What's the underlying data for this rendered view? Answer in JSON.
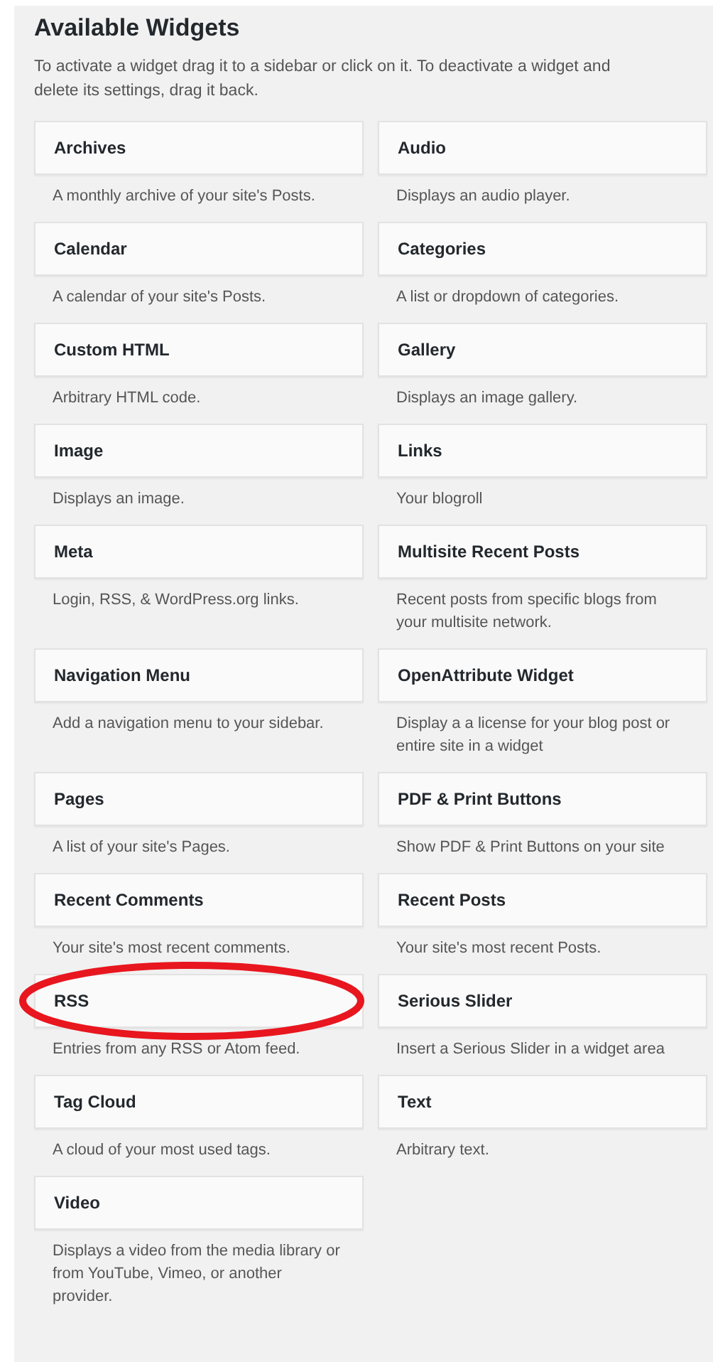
{
  "title": "Available Widgets",
  "intro": "To activate a widget drag it to a sidebar or click on it. To deactivate a widget and delete its settings, drag it back.",
  "widgets": [
    {
      "name": "Archives",
      "description": "A monthly archive of your site's Posts."
    },
    {
      "name": "Audio",
      "description": "Displays an audio player."
    },
    {
      "name": "Calendar",
      "description": "A calendar of your site's Posts."
    },
    {
      "name": "Categories",
      "description": "A list or dropdown of categories."
    },
    {
      "name": "Custom HTML",
      "description": "Arbitrary HTML code."
    },
    {
      "name": "Gallery",
      "description": "Displays an image gallery."
    },
    {
      "name": "Image",
      "description": "Displays an image."
    },
    {
      "name": "Links",
      "description": "Your blogroll"
    },
    {
      "name": "Meta",
      "description": "Login, RSS, & WordPress.org links."
    },
    {
      "name": "Multisite Recent Posts",
      "description": "Recent posts from specific blogs from your multisite network."
    },
    {
      "name": "Navigation Menu",
      "description": "Add a navigation menu to your sidebar."
    },
    {
      "name": "OpenAttribute Widget",
      "description": "Display a a license for your blog post or entire site in a widget"
    },
    {
      "name": "Pages",
      "description": "A list of your site's Pages."
    },
    {
      "name": "PDF & Print Buttons",
      "description": "Show PDF & Print Buttons on your site"
    },
    {
      "name": "Recent Comments",
      "description": "Your site's most recent comments."
    },
    {
      "name": "Recent Posts",
      "description": "Your site's most recent Posts."
    },
    {
      "name": "RSS",
      "description": "Entries from any RSS or Atom feed.",
      "circled": true
    },
    {
      "name": "Serious Slider",
      "description": "Insert a Serious Slider in a widget area"
    },
    {
      "name": "Tag Cloud",
      "description": "A cloud of your most used tags."
    },
    {
      "name": "Text",
      "description": "Arbitrary text."
    },
    {
      "name": "Video",
      "description": "Displays a video from the media library or from YouTube, Vimeo, or another provider."
    }
  ]
}
